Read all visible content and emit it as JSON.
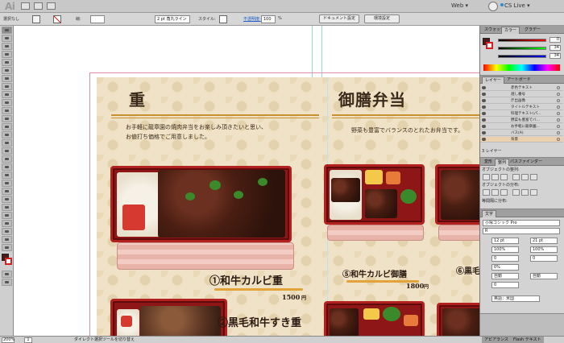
{
  "appbar": {
    "logo": "Ai",
    "workspace": "Web ▾",
    "cslive": "CS Live ▾"
  },
  "control_bar": {
    "selection_label": "選択なし",
    "stroke_label": "線:",
    "stroke_weight": "2 pt 角丸ライン",
    "style_label": "スタイル:",
    "opacity_label": "不透明度:",
    "opacity_value": "100",
    "opacity_unit": "%",
    "doc_setup": "ドキュメント設定",
    "preferences": "環境設定"
  },
  "menu": {
    "left_title": "重",
    "left_intro_1": "お手軽に龍章園の焼肉弁当をお楽しみ頂きたいと思い、",
    "left_intro_2": "お値打ち価格でご用意しました。",
    "item1_name": "①和牛カルビ重",
    "item1_price": "1500",
    "item1_unit": "円",
    "item2_name": "②黒毛和牛すき重",
    "right_title": "御膳弁当",
    "right_intro": "野菜も豊富でバランスのとれたお弁当です。",
    "item5_name": "⑤和牛カルビ御膳",
    "item5_price": "1800",
    "item5_unit": "円",
    "item6_name": "⑥黒毛"
  },
  "panels": {
    "color_tabs": [
      "スウォッチ",
      "カラー",
      "グラデー"
    ],
    "color_values": [
      "0",
      "34",
      "34"
    ],
    "layer_tabs": [
      "レイヤー",
      "アートボード"
    ],
    "layers": [
      "赤色テキスト",
      "週し番号",
      "斤出画像",
      "タイトルテキスト",
      "料理テキスト(パ...",
      "野菜も豊富でバ...",
      "お手軽に龍章園...",
      "バス(A)",
      "背景"
    ],
    "layers_footer": "3 レイヤー",
    "align_tabs": [
      "変形",
      "整列",
      "パスファインダー"
    ],
    "align_labels": [
      "オブジェクトの整列:",
      "オブジェクトの分布:",
      "等間隔に分布:"
    ],
    "type_tab": "文字",
    "font_name": "小塚ゴシック Pro",
    "font_style": "R",
    "font_size": "12 pt",
    "leading": "21 pt",
    "scale_h": "100%",
    "scale_v": "100%",
    "tracking": "0",
    "kerning": "0",
    "tsume": "0%",
    "auto": "自動",
    "language": "英語：米国"
  },
  "status": {
    "zoom": "200%",
    "page": "1",
    "message": "ダイレクト選択ツールを切り替え",
    "tab_appearance": "アピアランス",
    "tab_flash": "Flash テキスト"
  }
}
